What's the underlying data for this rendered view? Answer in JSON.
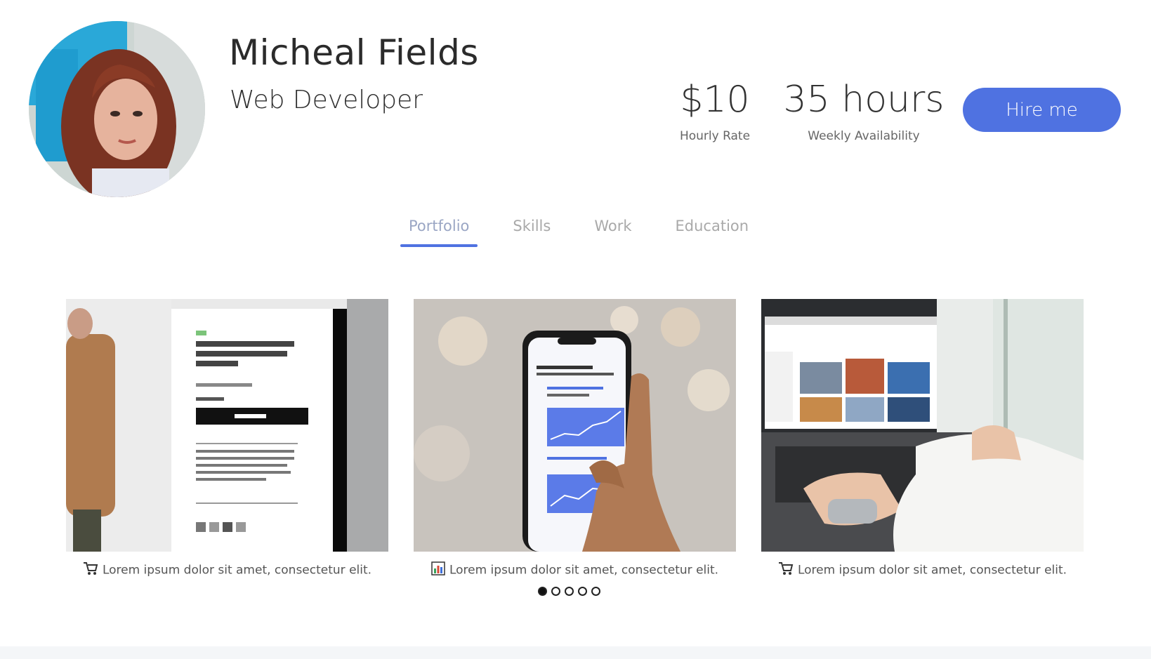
{
  "profile": {
    "name": "Micheal Fields",
    "title": "Web Developer",
    "stats": [
      {
        "value": "$10",
        "label": "Hourly Rate"
      },
      {
        "value": "35 hours",
        "label": "Weekly Availability"
      }
    ],
    "hire_label": "Hire me"
  },
  "tabs": [
    {
      "label": "Portfolio",
      "active": true
    },
    {
      "label": "Skills",
      "active": false
    },
    {
      "label": "Work",
      "active": false
    },
    {
      "label": "Education",
      "active": false
    }
  ],
  "portfolio": {
    "cards": [
      {
        "icon": "shopping-cart-icon",
        "caption": "Lorem ipsum dolor sit amet, consectetur elit."
      },
      {
        "icon": "bar-chart-icon",
        "caption": "Lorem ipsum dolor sit amet, consectetur elit."
      },
      {
        "icon": "shopping-cart-icon",
        "caption": "Lorem ipsum dolor sit amet, consectetur elit."
      }
    ],
    "carousel": {
      "total": 5,
      "active": 1
    }
  },
  "colors": {
    "accent": "#4f72e1",
    "text": "#2b2b2b",
    "muted": "#a9a9a9"
  }
}
